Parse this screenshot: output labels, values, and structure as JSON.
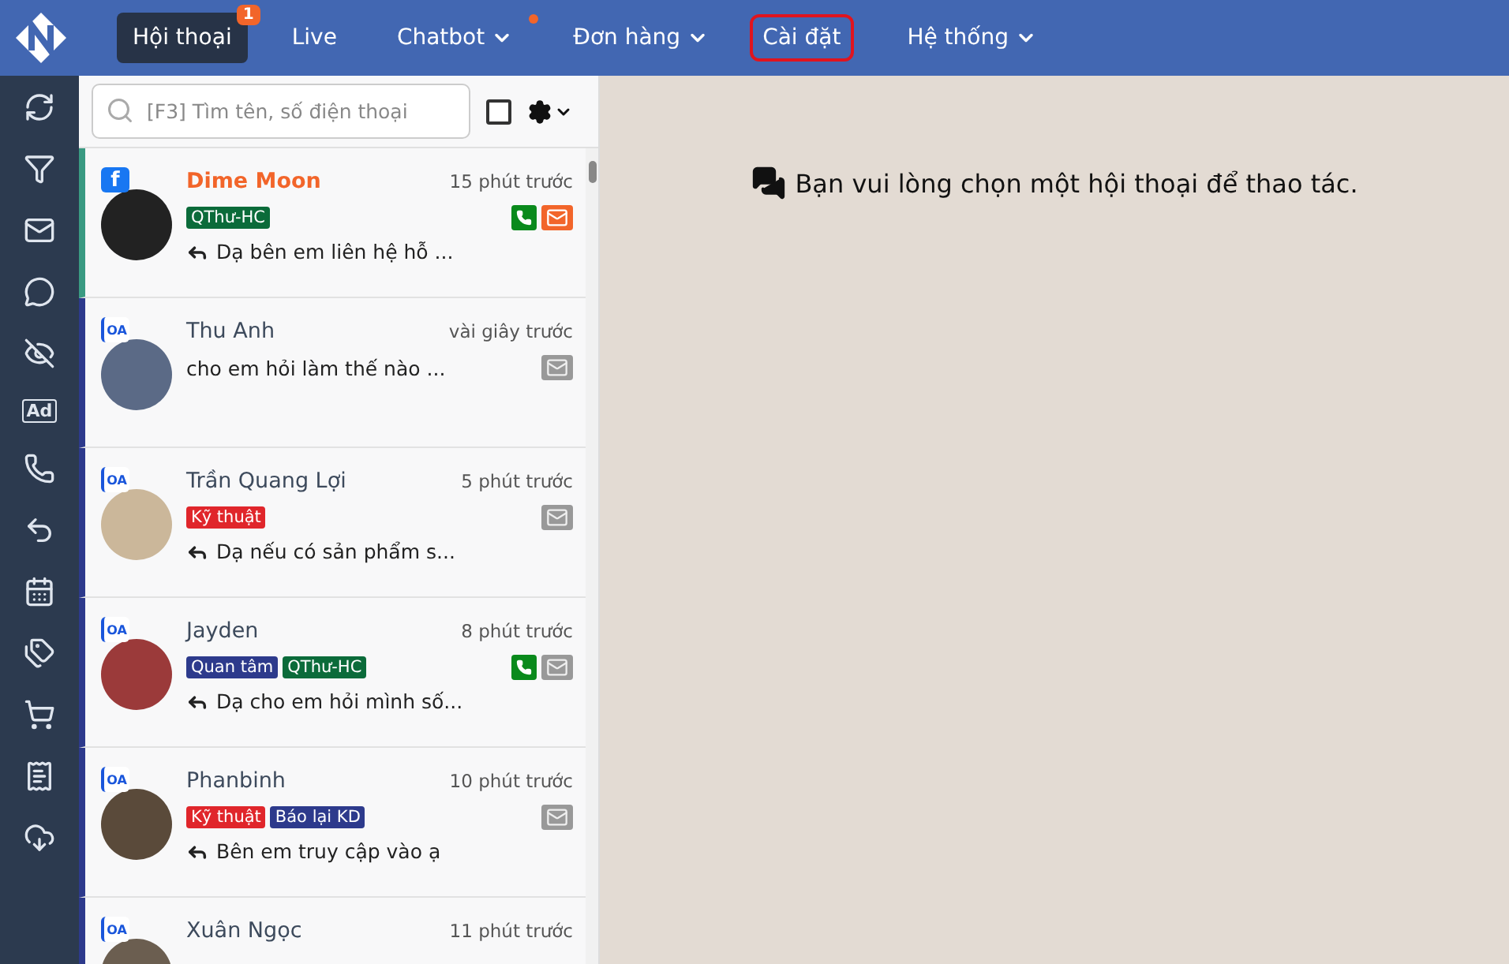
{
  "nav": {
    "items": [
      {
        "label": "Hội thoại",
        "selected": true,
        "badge": "1",
        "dropdown": false,
        "dot": false,
        "highlighted": false
      },
      {
        "label": "Live",
        "selected": false,
        "dropdown": false,
        "dot": false,
        "highlighted": false
      },
      {
        "label": "Chatbot",
        "selected": false,
        "dropdown": true,
        "dot": true,
        "highlighted": false
      },
      {
        "label": "Đơn hàng",
        "selected": false,
        "dropdown": true,
        "dot": false,
        "highlighted": false
      },
      {
        "label": "Cài đặt",
        "selected": false,
        "dropdown": false,
        "dot": false,
        "highlighted": true
      },
      {
        "label": "Hệ thống",
        "selected": false,
        "dropdown": true,
        "dot": false,
        "highlighted": false
      }
    ]
  },
  "sidebar": {
    "ad_label": "Ad"
  },
  "search": {
    "placeholder": "[F3] Tìm tên, số điện thoại",
    "select_all_checked": false
  },
  "conversations": [
    {
      "name": "Dime Moon",
      "time": "15 phút trước",
      "source": {
        "kind": "facebook",
        "label": "f"
      },
      "selected": true,
      "unread": true,
      "tags": [
        {
          "label": "QThư-HC",
          "color": "#0b6b3a"
        }
      ],
      "replied": true,
      "preview": "Dạ bên em liên hệ hỗ ...",
      "phone": true,
      "mail_active": true
    },
    {
      "name": "Thu Anh",
      "time": "vài giây trước",
      "source": {
        "kind": "zalo",
        "label": "OA"
      },
      "selected": false,
      "unread": false,
      "replied": false,
      "preview": "cho em hỏi làm thế nào ...",
      "phone": false,
      "mail_active": false
    },
    {
      "name": "Trần Quang Lợi",
      "time": "5 phút trước",
      "source": {
        "kind": "zalo",
        "label": "OA"
      },
      "selected": false,
      "unread": false,
      "tags": [
        {
          "label": "Kỹ thuật",
          "color": "#e0262b"
        }
      ],
      "replied": true,
      "preview": "Dạ nếu có sản phẩm s...",
      "phone": false,
      "mail_active": false
    },
    {
      "name": "Jayden",
      "time": "8 phút trước",
      "source": {
        "kind": "zalo",
        "label": "OA"
      },
      "selected": false,
      "unread": false,
      "tags": [
        {
          "label": "Quan tâm",
          "color": "#2d3a8c"
        },
        {
          "label": "QThư-HC",
          "color": "#0b6b3a"
        }
      ],
      "replied": true,
      "preview": "Dạ cho em hỏi mình số...",
      "phone": true,
      "mail_active": false
    },
    {
      "name": "Phanbinh",
      "time": "10 phút trước",
      "source": {
        "kind": "zalo",
        "label": "OA"
      },
      "selected": false,
      "unread": false,
      "tags": [
        {
          "label": "Kỹ thuật",
          "color": "#e0262b"
        },
        {
          "label": "Báo lại KD",
          "color": "#2d3a8c"
        }
      ],
      "replied": true,
      "preview": "Bên em truy cập vào ạ",
      "phone": false,
      "mail_active": false
    },
    {
      "name": "Xuân Ngọc",
      "time": "11 phút trước",
      "source": {
        "kind": "zalo",
        "label": "OA"
      },
      "selected": false,
      "unread": false
    }
  ],
  "empty_state": {
    "message": "Bạn vui lòng chọn một hội thoại để thao tác."
  }
}
